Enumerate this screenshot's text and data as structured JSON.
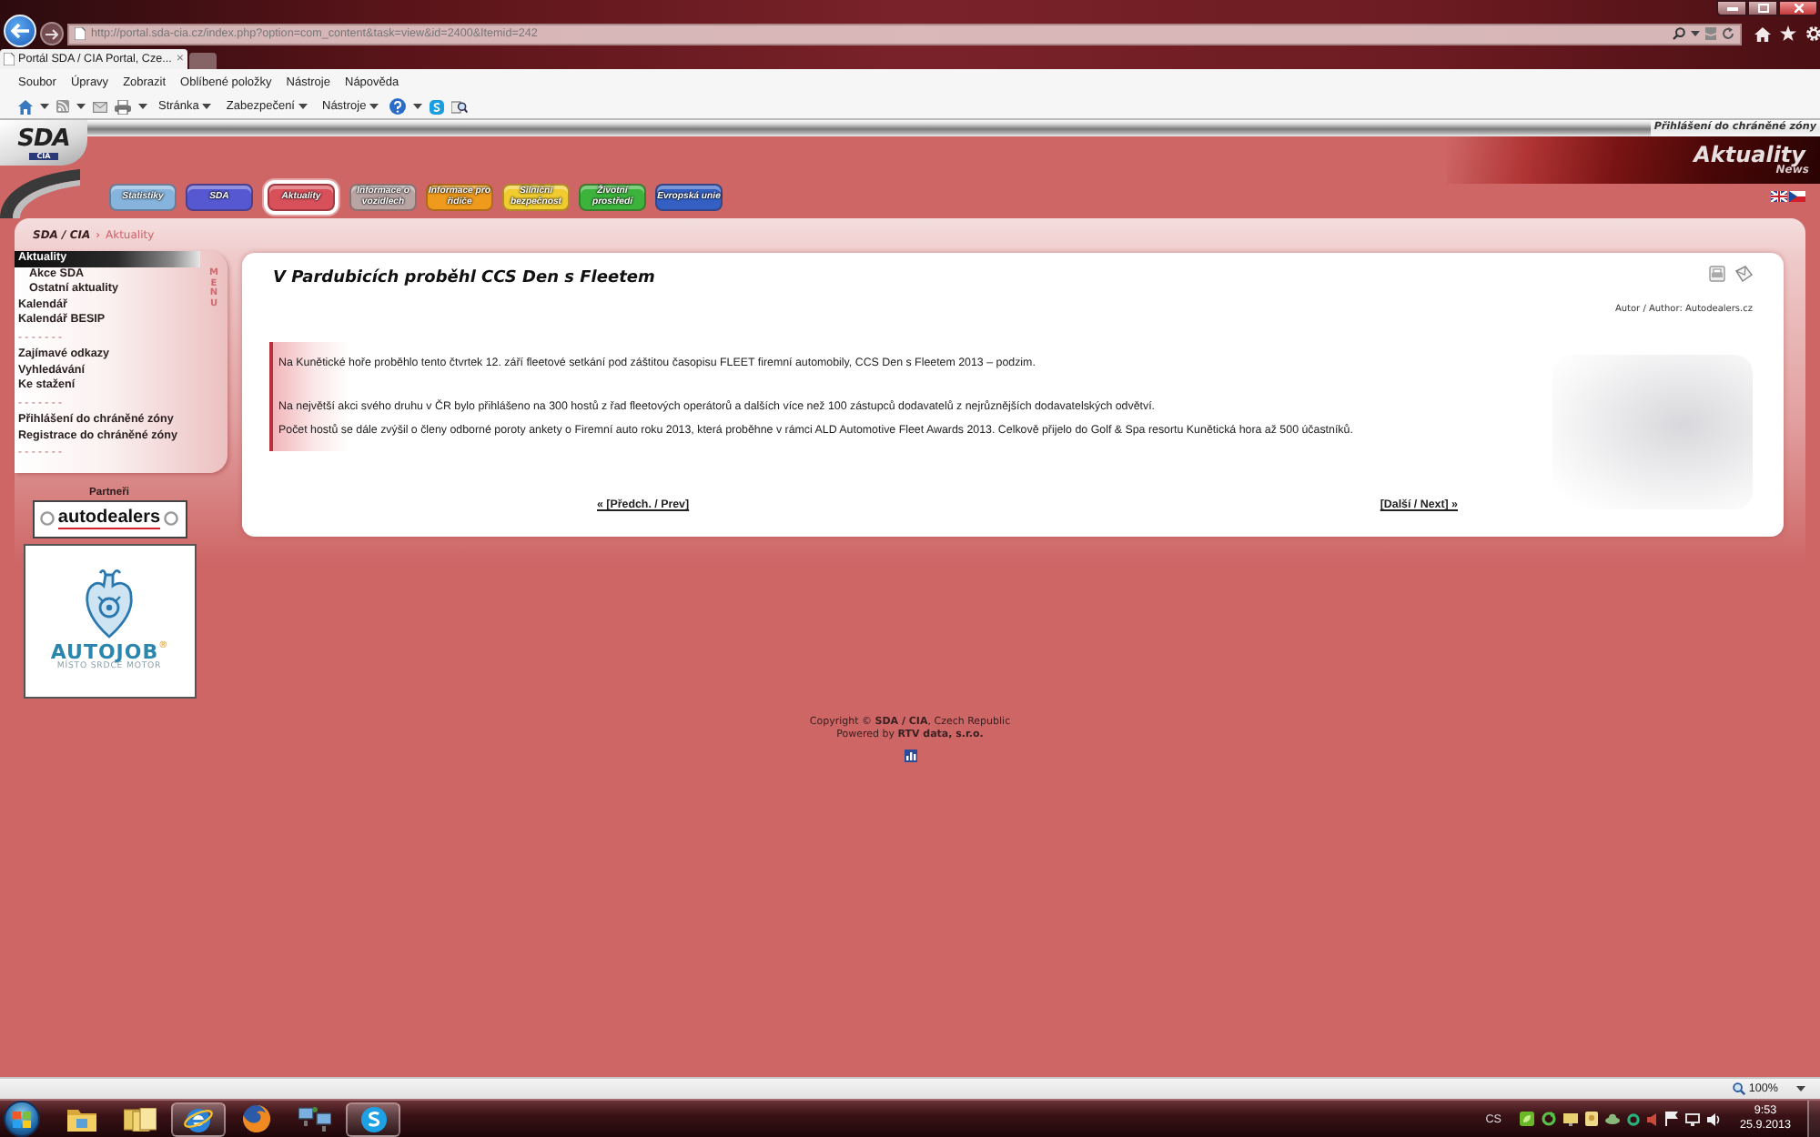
{
  "browser": {
    "address": "http://portal.sda-cia.cz/index.php?option=com_content&task=view&id=2400&Itemid=242",
    "tab": {
      "title": "Portál SDA / CIA Portal, Cze...",
      "close": "×"
    },
    "menu": [
      "Soubor",
      "Úpravy",
      "Zobrazit",
      "Oblíbené položky",
      "Nástroje",
      "Nápověda"
    ],
    "command_bar": [
      "Stránka",
      "Zabezpečení",
      "Nástroje"
    ]
  },
  "header": {
    "login_link": "Přihlášení do chráněné zóny",
    "logo": {
      "name": "SDA",
      "sub": "CIA"
    },
    "banner": {
      "title": "Aktuality",
      "subtitle": "News"
    }
  },
  "nav_tabs": [
    {
      "label": "Statistiky",
      "color": "#86b4dc",
      "selected": false
    },
    {
      "label": "SDA",
      "color": "#5558d0",
      "selected": false
    },
    {
      "label": "Aktuality",
      "color": "#d8505a",
      "selected": true
    },
    {
      "label": "Informace o vozidlech",
      "color": "#b9a4a4",
      "selected": false
    },
    {
      "label": "Informace pro řidiče",
      "color": "#ee9a1c",
      "selected": false
    },
    {
      "label": "Silniční bezpečnost",
      "color": "#f0cc30",
      "selected": false
    },
    {
      "label": "Životní prostředí",
      "color": "#3cb43c",
      "selected": false
    },
    {
      "label": "Evropská unie",
      "color": "#3460c4",
      "selected": false
    }
  ],
  "breadcrumb": {
    "items": [
      "SDA / CIA",
      "Aktuality"
    ],
    "separator": "›"
  },
  "sidebar": {
    "menu_label": "MENU",
    "items": [
      {
        "kind": "link",
        "label": "Aktuality",
        "selected": true,
        "children": [
          {
            "kind": "link",
            "label": "Akce SDA",
            "selected": false
          },
          {
            "kind": "link",
            "label": "Ostatní aktuality",
            "selected": false
          }
        ]
      },
      {
        "kind": "link",
        "label": "Kalendář",
        "selected": false
      },
      {
        "kind": "link",
        "label": "Kalendář BESIP",
        "selected": false
      },
      {
        "kind": "separator",
        "label": "- - - - - - -"
      },
      {
        "kind": "link",
        "label": "Zajímavé odkazy",
        "selected": false
      },
      {
        "kind": "link",
        "label": "Vyhledávání",
        "selected": false
      },
      {
        "kind": "link",
        "label": "Ke stažení",
        "selected": false
      },
      {
        "kind": "separator",
        "label": "- - - - - - -"
      },
      {
        "kind": "link",
        "label": "Přihlášení do chráněné zóny",
        "selected": false
      },
      {
        "kind": "link",
        "label": "Registrace do chráněné zóny",
        "selected": false
      },
      {
        "kind": "separator",
        "label": "- - - - - - -"
      }
    ]
  },
  "partners": {
    "heading": "Partneři",
    "logos": [
      {
        "kind": "autodealers",
        "text": "autodealers"
      },
      {
        "kind": "autojob",
        "text": "AUTOJOB",
        "mark": "®",
        "tagline": "MÍSTO SRDCE MOTOR"
      }
    ]
  },
  "article": {
    "title": "V Pardubicích proběhl CCS Den s Fleetem",
    "author": "Autor / Author: Autodealers.cz",
    "paragraphs": [
      {
        "lines": [
          "Na Kunětické hoře proběhlo tento čtvrtek 12. září fleetové setkání pod záštitou časopisu FLEET firemní automobily, CCS Den s Fleetem 2013 – podzim."
        ]
      },
      {
        "lines": [
          "Na největší akci svého druhu v ČR bylo přihlášeno na 300 hostů z řad fleetových operátorů a dalších více než 100 zástupců dodavatelů z nejrůznějších dodavatelských odvětví.",
          "Počet hostů se dále zvýšil o členy odborné poroty ankety o Firemní auto roku 2013, která proběhne v rámci ALD Automotive Fleet Awards 2013. Celkově přijelo do Golf & Spa resortu Kunětická hora až 500 účastníků."
        ]
      }
    ],
    "prev_link": "« [Předch. / Prev]",
    "next_link": "[Další / Next] »"
  },
  "footer": {
    "lines": [
      "Copyright © **SDA / CIA**, Czech Republic",
      "Powered by **RTV data, s.r.o.**"
    ]
  },
  "status_bar": {
    "zoom": "100%"
  },
  "taskbar": {
    "apps": [
      {
        "kind": "explorer",
        "running": false
      },
      {
        "kind": "libraries",
        "running": false
      },
      {
        "kind": "browser",
        "running": true
      },
      {
        "kind": "firefox",
        "running": false
      },
      {
        "kind": "network",
        "running": false
      },
      {
        "kind": "chat",
        "running": true
      }
    ],
    "language": "CS",
    "time": "9:53",
    "date": "25.9.2013"
  }
}
